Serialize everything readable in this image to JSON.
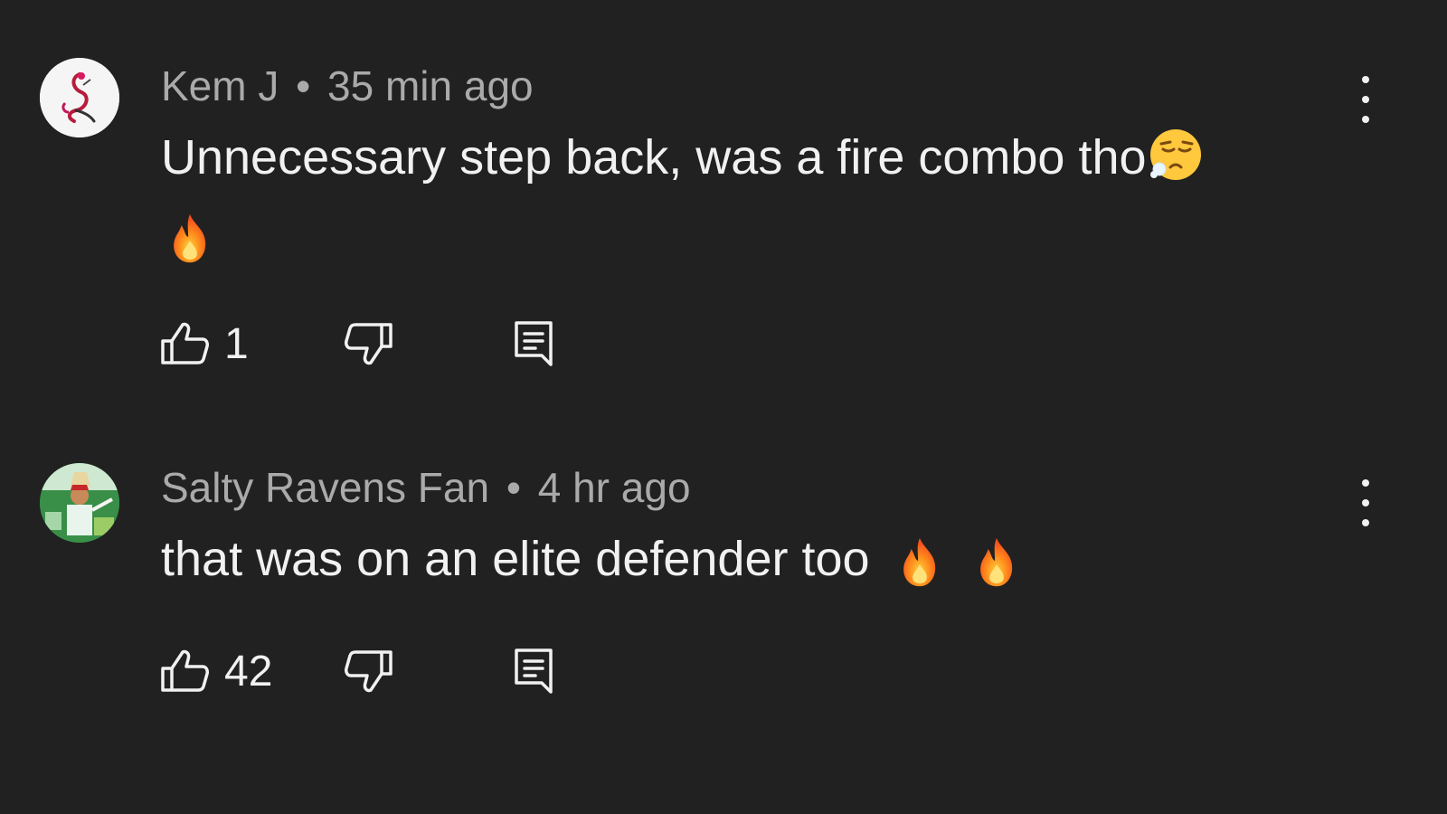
{
  "comments": [
    {
      "author": "Kem J",
      "separator": "•",
      "time": "35 min ago",
      "text": "Unnecessary step back, was a fire combo tho",
      "emoji_inline": "exhaling-face-emoji",
      "emoji_second_line": [
        "fire-emoji"
      ],
      "likes": "1"
    },
    {
      "author": "Salty Ravens Fan",
      "separator": "•",
      "time": "4 hr ago",
      "text": "that was on an elite defender too",
      "emoji_inline": [
        "fire-emoji",
        "fire-emoji"
      ],
      "likes": "42"
    }
  ],
  "colors": {
    "background": "#212121",
    "meta_text": "#aaaaaa",
    "body_text": "#f1f1f1",
    "icon": "#f1f1f1"
  },
  "icons": {
    "like": "thumbs-up-icon",
    "dislike": "thumbs-down-icon",
    "reply": "reply-comment-icon",
    "menu": "more-vertical-icon"
  }
}
